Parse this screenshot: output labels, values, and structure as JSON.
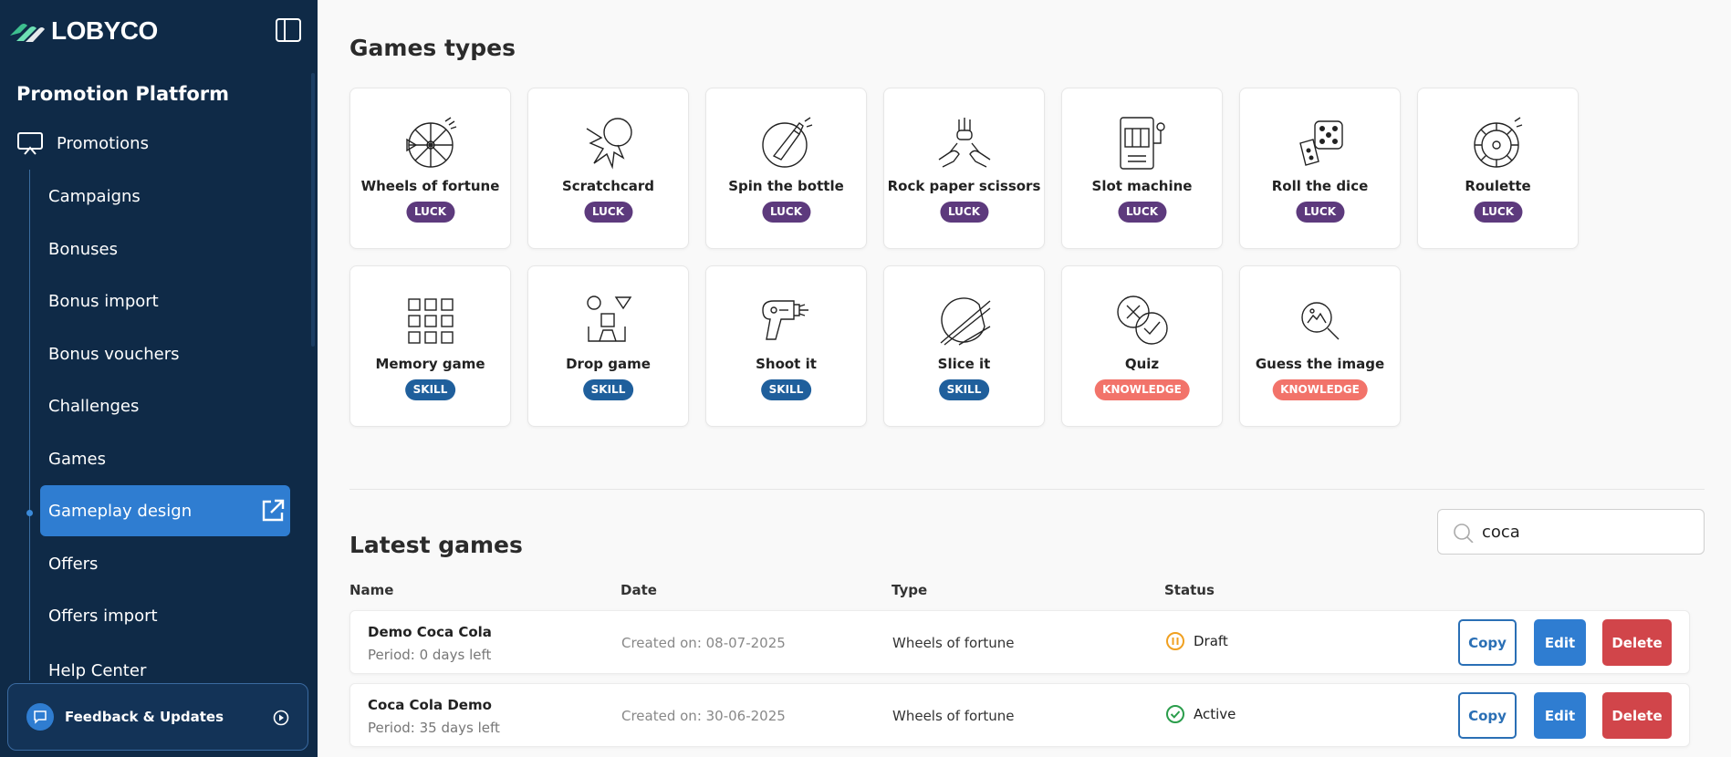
{
  "brand": {
    "name": "LOBYCO"
  },
  "sidebar": {
    "platform_title": "Promotion Platform",
    "parent_label": "Promotions",
    "items": [
      {
        "label": "Campaigns"
      },
      {
        "label": "Bonuses"
      },
      {
        "label": "Bonus import"
      },
      {
        "label": "Bonus vouchers"
      },
      {
        "label": "Challenges"
      },
      {
        "label": "Games"
      },
      {
        "label": "Gameplay design"
      },
      {
        "label": "Offers"
      },
      {
        "label": "Offers import"
      },
      {
        "label": "Help Center"
      }
    ],
    "feedback_label": "Feedback & Updates"
  },
  "games_types": {
    "title": "Games types",
    "cards": [
      {
        "name": "Wheels of fortune",
        "badge": "LUCK",
        "icon": "wheel-icon"
      },
      {
        "name": "Scratchcard",
        "badge": "LUCK",
        "icon": "scratchcard-icon"
      },
      {
        "name": "Spin the bottle",
        "badge": "LUCK",
        "icon": "bottle-icon"
      },
      {
        "name": "Rock paper scissors",
        "badge": "LUCK",
        "icon": "hands-icon"
      },
      {
        "name": "Slot machine",
        "badge": "LUCK",
        "icon": "slot-machine-icon"
      },
      {
        "name": "Roll the dice",
        "badge": "LUCK",
        "icon": "dice-icon"
      },
      {
        "name": "Roulette",
        "badge": "LUCK",
        "icon": "roulette-icon"
      },
      {
        "name": "Memory game",
        "badge": "SKILL",
        "icon": "memory-grid-icon"
      },
      {
        "name": "Drop game",
        "badge": "SKILL",
        "icon": "drop-shapes-icon"
      },
      {
        "name": "Shoot it",
        "badge": "SKILL",
        "icon": "blaster-icon"
      },
      {
        "name": "Slice it",
        "badge": "SKILL",
        "icon": "slice-icon"
      },
      {
        "name": "Quiz",
        "badge": "KNOWLEDGE",
        "icon": "quiz-icon"
      },
      {
        "name": "Guess the image",
        "badge": "KNOWLEDGE",
        "icon": "magnifier-image-icon"
      }
    ]
  },
  "latest_games": {
    "title": "Latest games",
    "search": {
      "value": "coca"
    },
    "columns": {
      "name": "Name",
      "date": "Date",
      "type": "Type",
      "status": "Status"
    },
    "rows": [
      {
        "name": "Demo Coca Cola",
        "period": "Period: 0 days left",
        "date": "Created on: 08-07-2025",
        "type": "Wheels of fortune",
        "status": "Draft"
      },
      {
        "name": "Coca Cola Demo",
        "period": "Period: 35 days left",
        "date": "Created on: 30-06-2025",
        "type": "Wheels of fortune",
        "status": "Active"
      }
    ],
    "actions": {
      "copy": "Copy",
      "edit": "Edit",
      "delete": "Delete"
    }
  },
  "colors": {
    "sidebar_bg": "#0f2a47",
    "active_item": "#2f7dd1",
    "luck": "#5d3a7d",
    "skill": "#1f5f9c",
    "knowledge": "#f2736a",
    "delete": "#d1454a",
    "draft": "#f0a020",
    "active_status": "#2a9d4b"
  }
}
